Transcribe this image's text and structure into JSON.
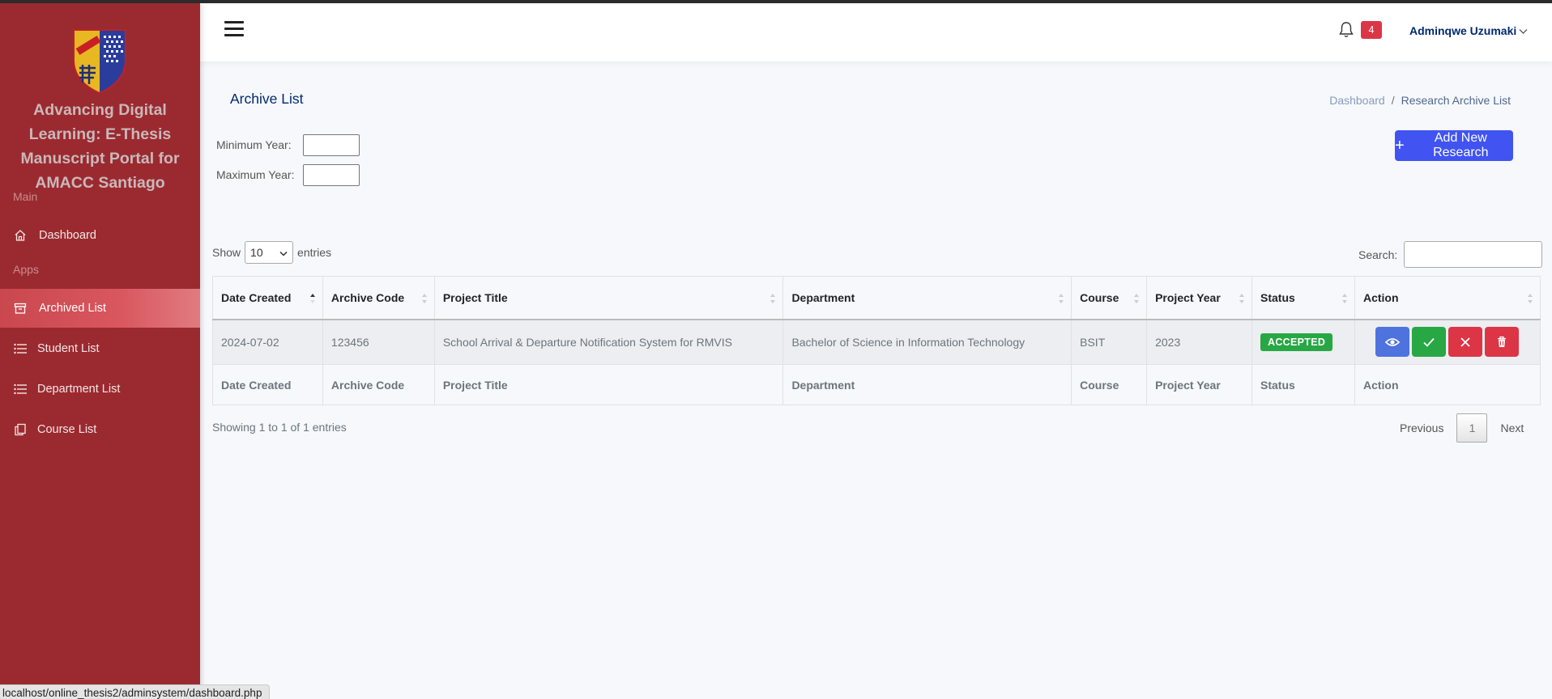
{
  "app": {
    "brand_title": "Advancing Digital Learning: E-Thesis Manuscript Portal for AMACC Santiago"
  },
  "sidebar": {
    "section_main": "Main",
    "section_apps": "Apps",
    "items": [
      {
        "label": "Dashboard",
        "icon": "house-icon"
      },
      {
        "label": "Archived List",
        "icon": "archive-icon",
        "active": true
      },
      {
        "label": "Student List",
        "icon": "list-icon"
      },
      {
        "label": "Department List",
        "icon": "list-icon"
      },
      {
        "label": "Course List",
        "icon": "copy-icon"
      }
    ]
  },
  "header": {
    "notification_count": "4",
    "user_name": "Adminqwe Uzumaki"
  },
  "page": {
    "title": "Archive List",
    "breadcrumb": [
      "Dashboard",
      "Research Archive List"
    ],
    "add_button": "Add New Research"
  },
  "filters": {
    "min_year_label": "Minimum Year:",
    "max_year_label": "Maximum Year:"
  },
  "table_controls": {
    "show_label": "Show",
    "entries_value": "10",
    "entries_label": "entries",
    "search_label": "Search:"
  },
  "table": {
    "columns": [
      "Date Created",
      "Archive Code",
      "Project Title",
      "Department",
      "Course",
      "Project Year",
      "Status",
      "Action"
    ],
    "rows": [
      {
        "date_created": "2024-07-02",
        "archive_code": "123456",
        "project_title": "School Arrival & Departure Notification System for RMVIS",
        "department": "Bachelor of Science in Information Technology",
        "course": "BSIT",
        "project_year": "2023",
        "status": "ACCEPTED"
      }
    ]
  },
  "pagination": {
    "info": "Showing 1 to 1 of 1 entries",
    "previous": "Previous",
    "current": "1",
    "next": "Next"
  },
  "statusbar": {
    "url": "localhost/online_thesis2/adminsystem/dashboard.php"
  },
  "colors": {
    "sidebar": "#9b2a30",
    "accent": "#4154f1",
    "success": "#28a745",
    "danger": "#dc3545"
  }
}
